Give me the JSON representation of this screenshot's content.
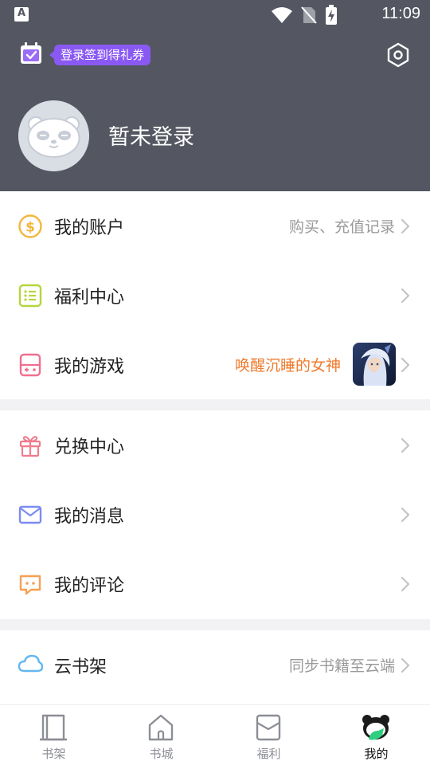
{
  "status_bar": {
    "time": "11:09"
  },
  "header": {
    "checkin_badge": "登录签到得礼券",
    "login_text": "暂未登录"
  },
  "menu": {
    "account": {
      "label": "我的账户",
      "hint": "购买、充值记录"
    },
    "welfare": {
      "label": "福利中心"
    },
    "games": {
      "label": "我的游戏",
      "hint": "唤醒沉睡的女神"
    },
    "redeem": {
      "label": "兑换中心"
    },
    "messages": {
      "label": "我的消息"
    },
    "comments": {
      "label": "我的评论"
    },
    "cloud_shelf": {
      "label": "云书架",
      "hint": "同步书籍至云端"
    }
  },
  "tabs": [
    {
      "label": "书架",
      "icon": "bookshelf-icon"
    },
    {
      "label": "书城",
      "icon": "bookstore-icon"
    },
    {
      "label": "福利",
      "icon": "welfare-icon"
    },
    {
      "label": "我的",
      "icon": "profile-icon"
    }
  ],
  "colors": {
    "header_bg": "#545762",
    "badge_purple": "#8a59f3",
    "game_hint_orange": "#f07a2c",
    "active_tab_green": "#2fcf7f"
  }
}
